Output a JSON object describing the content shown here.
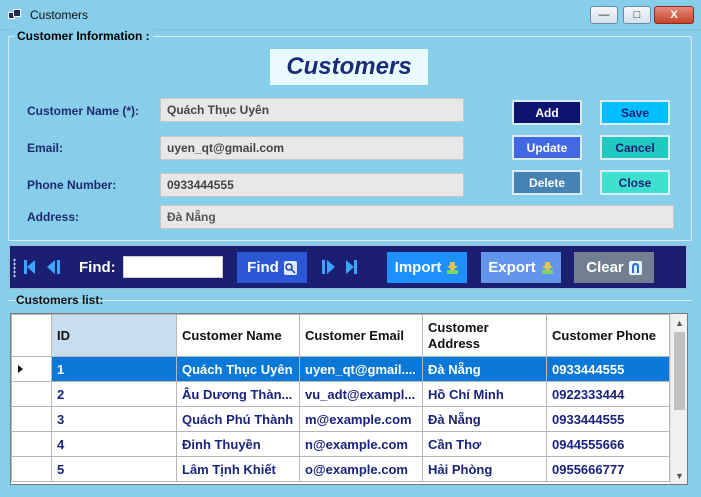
{
  "window": {
    "title": "Customers",
    "minimize_glyph": "—",
    "maximize_glyph": "□",
    "close_glyph": "X"
  },
  "form": {
    "group_title": "Customer Information :",
    "heading": "Customers",
    "name_label": "Customer Name (*):",
    "name_value": "Quách Thục Uyên",
    "email_label": "Email:",
    "email_value": "uyen_qt@gmail.com",
    "phone_label": "Phone Number:",
    "phone_value": "0933444555",
    "address_label": "Address:",
    "address_value": "Đà Nẵng"
  },
  "buttons": {
    "add": "Add",
    "save": "Save",
    "update": "Update",
    "cancel": "Cancel",
    "delete": "Delete",
    "close": "Close"
  },
  "toolbar": {
    "find_label": "Find:",
    "find_value": "",
    "find_button": "Find",
    "import_button": "Import",
    "export_button": "Export",
    "clear_button": "Clear"
  },
  "list": {
    "title": "Customers list:",
    "columns": [
      "ID",
      "Customer Name",
      "Customer Email",
      "Customer Address",
      "Customer Phone"
    ],
    "rows": [
      {
        "id": "1",
        "name": "Quách Thục Uyên",
        "email": "uyen_qt@gmail....",
        "address": "Đà Nẵng",
        "phone": "0933444555"
      },
      {
        "id": "2",
        "name": "Âu Dương Thàn...",
        "email": "vu_adt@exampl...",
        "address": "Hồ Chí Minh",
        "phone": "0922333444"
      },
      {
        "id": "3",
        "name": "Quách Phú Thành",
        "email": "m@example.com",
        "address": "Đà Nẵng",
        "phone": "0933444555"
      },
      {
        "id": "4",
        "name": "Đinh Thuyền",
        "email": "n@example.com",
        "address": "Cần Thơ",
        "phone": "0944555666"
      },
      {
        "id": "5",
        "name": "Lâm Tịnh Khiết",
        "email": "o@example.com",
        "address": "Hải Phòng",
        "phone": "0955666777"
      }
    ],
    "selected_row": 0
  },
  "colors": {
    "window_bg": "#87ceeb",
    "heading_text": "#1a2c74",
    "label_text": "#1e2a6e",
    "toolbar_bg": "#1a1f72",
    "selection": "#0a78d7",
    "add_bg": "#0d1470",
    "save_bg": "#00bfff",
    "update_bg": "#4169e1",
    "cancel_bg": "#20c9c0",
    "delete_bg": "#4682b4",
    "close_bg": "#40e0d0",
    "find_btn_bg": "#2b57d4",
    "import_btn_bg": "#1e90ff",
    "export_btn_bg": "#6495ed",
    "clear_btn_bg": "#708090"
  },
  "icons": {
    "app": "window-icon",
    "first": "first-record-icon",
    "prev": "previous-record-icon",
    "next": "next-record-icon",
    "last": "last-record-icon",
    "find": "search-icon",
    "import": "import-arrow-icon",
    "export": "export-arrow-icon",
    "clear": "clear-icon",
    "row_pointer": "current-row-arrow-icon"
  }
}
